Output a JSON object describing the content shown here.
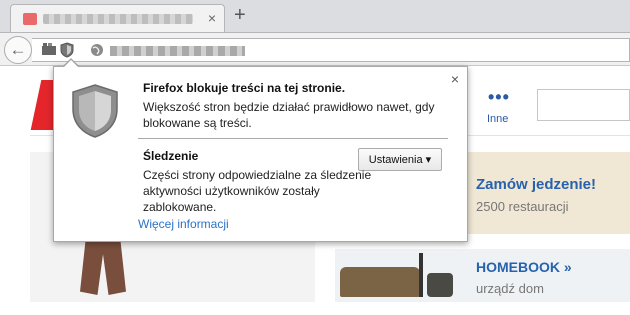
{
  "browser": {
    "tab": {
      "close_glyph": "×"
    },
    "new_tab_glyph": "+",
    "back_glyph": "←",
    "icons": [
      "back-arrow-icon",
      "library-icon",
      "tracking-shield-icon",
      "globe-icon"
    ]
  },
  "page": {
    "nav_more_dots": "•••",
    "nav_more_label": "Inne",
    "ad1": {
      "title": "Zamów jedzenie!",
      "subtitle": "2500 restauracji"
    },
    "ad2": {
      "title": "HOMEBOOK »",
      "subtitle": "urządź dom"
    }
  },
  "panel": {
    "close_glyph": "×",
    "title": "Firefox blokuje treści na tej stronie.",
    "description": "Większość stron będzie działać prawidłowo nawet, gdy blokowane są treści.",
    "section_title": "Śledzenie",
    "section_description": "Części strony odpowiedzialne za śledzenie aktywności użytkowników zostały zablokowane.",
    "settings_button": "Ustawienia ▾",
    "more_info_link": "Więcej informacji"
  },
  "colors": {
    "accent_link": "#2b73c8",
    "brand_red": "#e4262b",
    "ad_title_blue": "#2662ad"
  }
}
